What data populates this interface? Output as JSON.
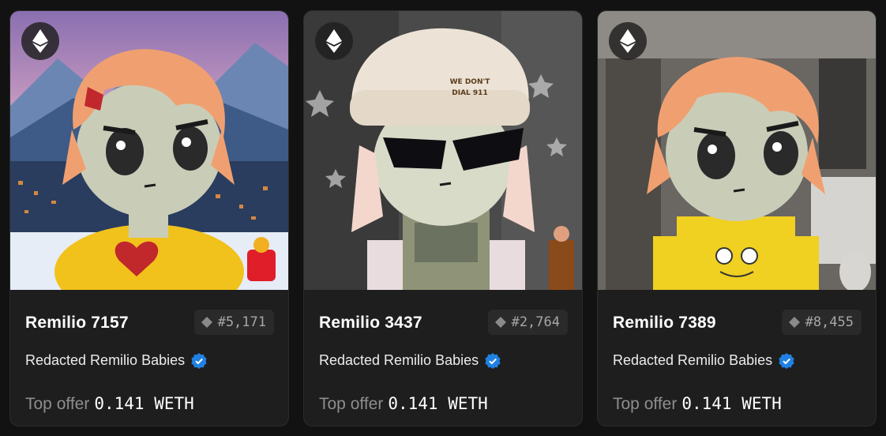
{
  "cards": [
    {
      "name": "Remilio 7157",
      "rank": "#5,171",
      "collection": "Redacted Remilio Babies",
      "offer_label": "Top offer",
      "offer_value": "0.141 WETH",
      "accent": "#f2c21c"
    },
    {
      "name": "Remilio 3437",
      "rank": "#2,764",
      "collection": "Redacted Remilio Babies",
      "offer_label": "Top offer",
      "offer_value": "0.141 WETH",
      "hat_text_1": "WE DON'T",
      "hat_text_2": "DIAL 911",
      "accent": "#ece3d6"
    },
    {
      "name": "Remilio 7389",
      "rank": "#8,455",
      "collection": "Redacted Remilio Babies",
      "offer_label": "Top offer",
      "offer_value": "0.141 WETH",
      "accent": "#f0d020"
    }
  ],
  "icons": {
    "chain": "ethereum-icon",
    "rank": "diamond-icon",
    "verified": "verified-badge-icon"
  },
  "colors": {
    "background": "#121212",
    "card": "#1e1e1e",
    "verified": "#2081e2",
    "muted_text": "#8e8e8e"
  }
}
